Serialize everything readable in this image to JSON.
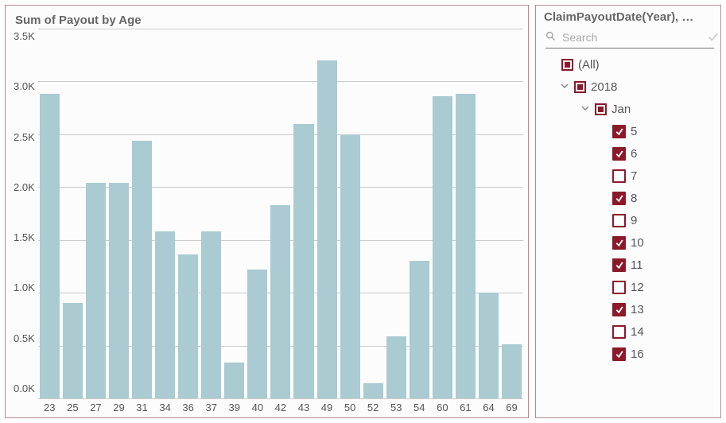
{
  "chart_data": {
    "type": "bar",
    "title": "Sum of Payout by Age",
    "xlabel": "",
    "ylabel": "",
    "ylim": [
      0,
      3500
    ],
    "y_ticks": [
      "3.5K",
      "3.0K",
      "2.5K",
      "2.0K",
      "1.5K",
      "1.0K",
      "0.5K",
      "0.0K"
    ],
    "categories": [
      "23",
      "25",
      "27",
      "29",
      "31",
      "34",
      "36",
      "37",
      "39",
      "40",
      "42",
      "43",
      "49",
      "50",
      "52",
      "53",
      "54",
      "60",
      "61",
      "64",
      "69"
    ],
    "values": [
      2880,
      900,
      2040,
      2040,
      2440,
      1580,
      1360,
      1580,
      340,
      1220,
      1830,
      2600,
      3200,
      2490,
      140,
      590,
      1300,
      2860,
      2880,
      1000,
      510
    ]
  },
  "filter": {
    "title_full": "ClaimPayoutDate(Year), …",
    "search_placeholder": "Search",
    "tree": {
      "all_label": "(All)",
      "year_label": "2018",
      "month_label": "Jan",
      "days": [
        {
          "label": "5",
          "checked": true
        },
        {
          "label": "6",
          "checked": true
        },
        {
          "label": "7",
          "checked": false
        },
        {
          "label": "8",
          "checked": true
        },
        {
          "label": "9",
          "checked": false
        },
        {
          "label": "10",
          "checked": true
        },
        {
          "label": "11",
          "checked": true
        },
        {
          "label": "12",
          "checked": false
        },
        {
          "label": "13",
          "checked": true
        },
        {
          "label": "14",
          "checked": false
        },
        {
          "label": "16",
          "checked": true
        }
      ]
    }
  }
}
